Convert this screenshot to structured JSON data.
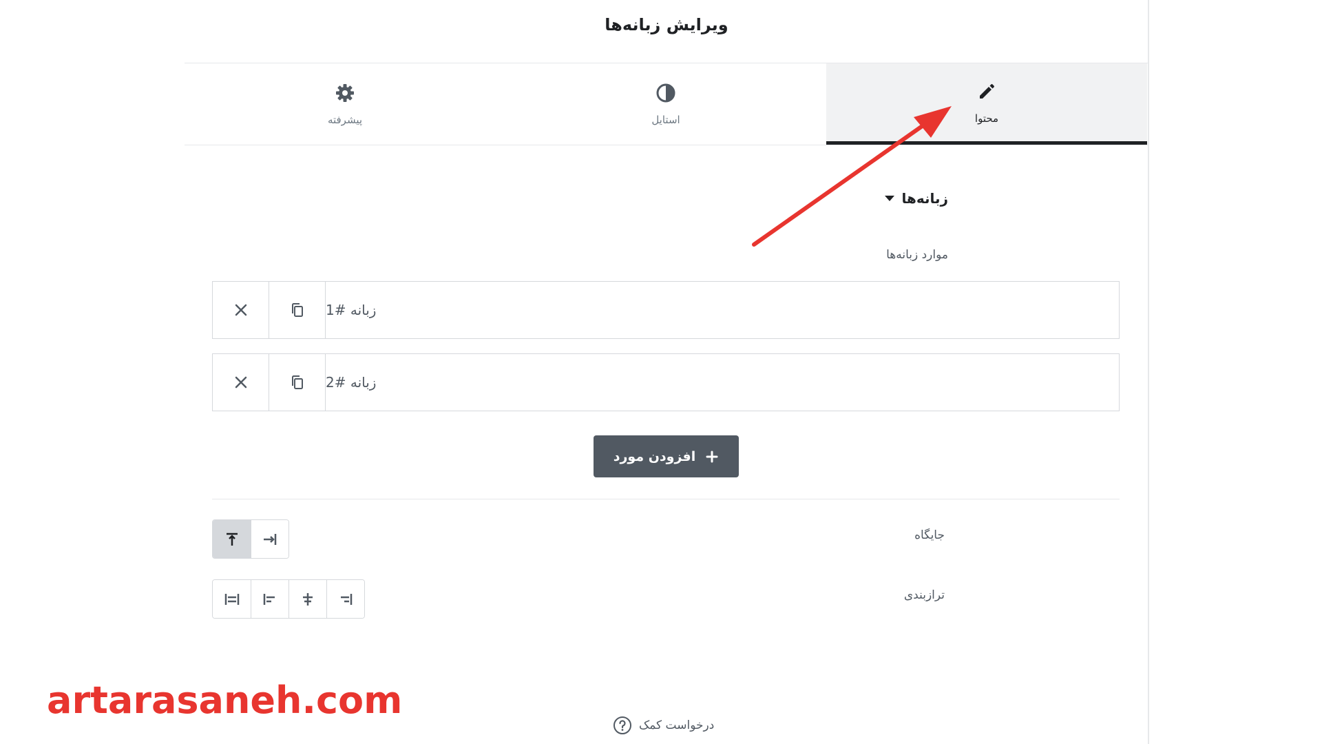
{
  "header": {
    "title": "ویرایش زبانه‌ها"
  },
  "tabs": [
    {
      "label": "محتوا",
      "icon": "pencil-icon",
      "active": true
    },
    {
      "label": "استایل",
      "icon": "contrast-icon",
      "active": false
    },
    {
      "label": "پیشرفته",
      "icon": "gear-icon",
      "active": false
    }
  ],
  "section": {
    "title": "زبانه‌ها",
    "items_label": "موارد زبانه‌ها"
  },
  "repeater_items": [
    {
      "title": "زبانه #1"
    },
    {
      "title": "زبانه #2"
    }
  ],
  "add_button": {
    "label": "افزودن مورد"
  },
  "position": {
    "label": "جایگاه"
  },
  "alignment": {
    "label": "ترازبندی"
  },
  "help": {
    "label": "درخواست کمک"
  },
  "watermark": {
    "text": "artarasaneh.com"
  },
  "colors": {
    "accent_arrow": "#e8352f",
    "dark_button": "#515962",
    "active_tab": "#f1f2f3"
  }
}
